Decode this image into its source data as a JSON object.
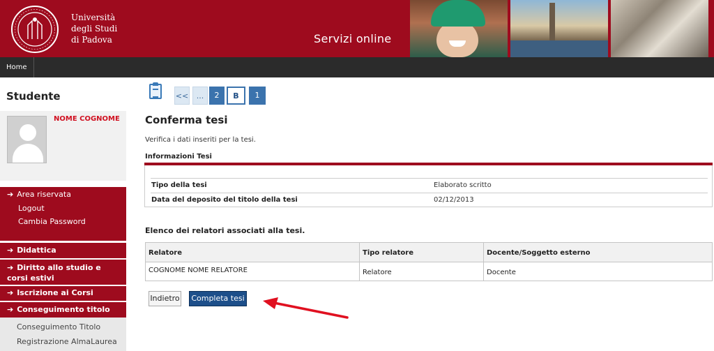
{
  "header": {
    "university_lines": [
      "Università",
      "degli Studi",
      "di Padova"
    ],
    "services_label": "Servizi online"
  },
  "nav": {
    "home_label": "Home"
  },
  "sidebar": {
    "title": "Studente",
    "user_name": "NOME COGNOME",
    "area_riservata": "Area riservata",
    "logout": "Logout",
    "cambia_password": "Cambia Password",
    "menu": [
      {
        "label": "Didattica"
      },
      {
        "label": "Diritto allo studio e corsi estivi"
      },
      {
        "label": "Iscrizione ai Corsi"
      },
      {
        "label": "Conseguimento titolo"
      }
    ],
    "sub_links": [
      "Conseguimento Titolo",
      "Registrazione AlmaLaurea"
    ]
  },
  "pager": {
    "first": "<<",
    "ellipsis": "...",
    "p2": "2",
    "current": "B",
    "p1": "1"
  },
  "main": {
    "title": "Conferma tesi",
    "description": "Verifica i dati inseriti per la tesi.",
    "info_section_title": "Informazioni Tesi",
    "info_rows": [
      {
        "key": "Tipo della tesi",
        "value": "Elaborato scritto"
      },
      {
        "key": "Data del deposito del titolo della tesi",
        "value": "02/12/2013"
      }
    ],
    "relatori_title": "Elenco dei relatori associati alla tesi.",
    "relatori_headers": [
      "Relatore",
      "Tipo relatore",
      "Docente/Soggetto esterno"
    ],
    "relatori_rows": [
      [
        "COGNOME NOME RELATORE",
        "Relatore",
        "Docente"
      ]
    ],
    "back_label": "Indietro",
    "complete_label": "Completa tesi"
  },
  "colors": {
    "brand_red": "#9e0b1e",
    "nav_dark": "#2b2b2b",
    "button_blue": "#1d4f8a",
    "annotation_arrow": "#e01020"
  }
}
